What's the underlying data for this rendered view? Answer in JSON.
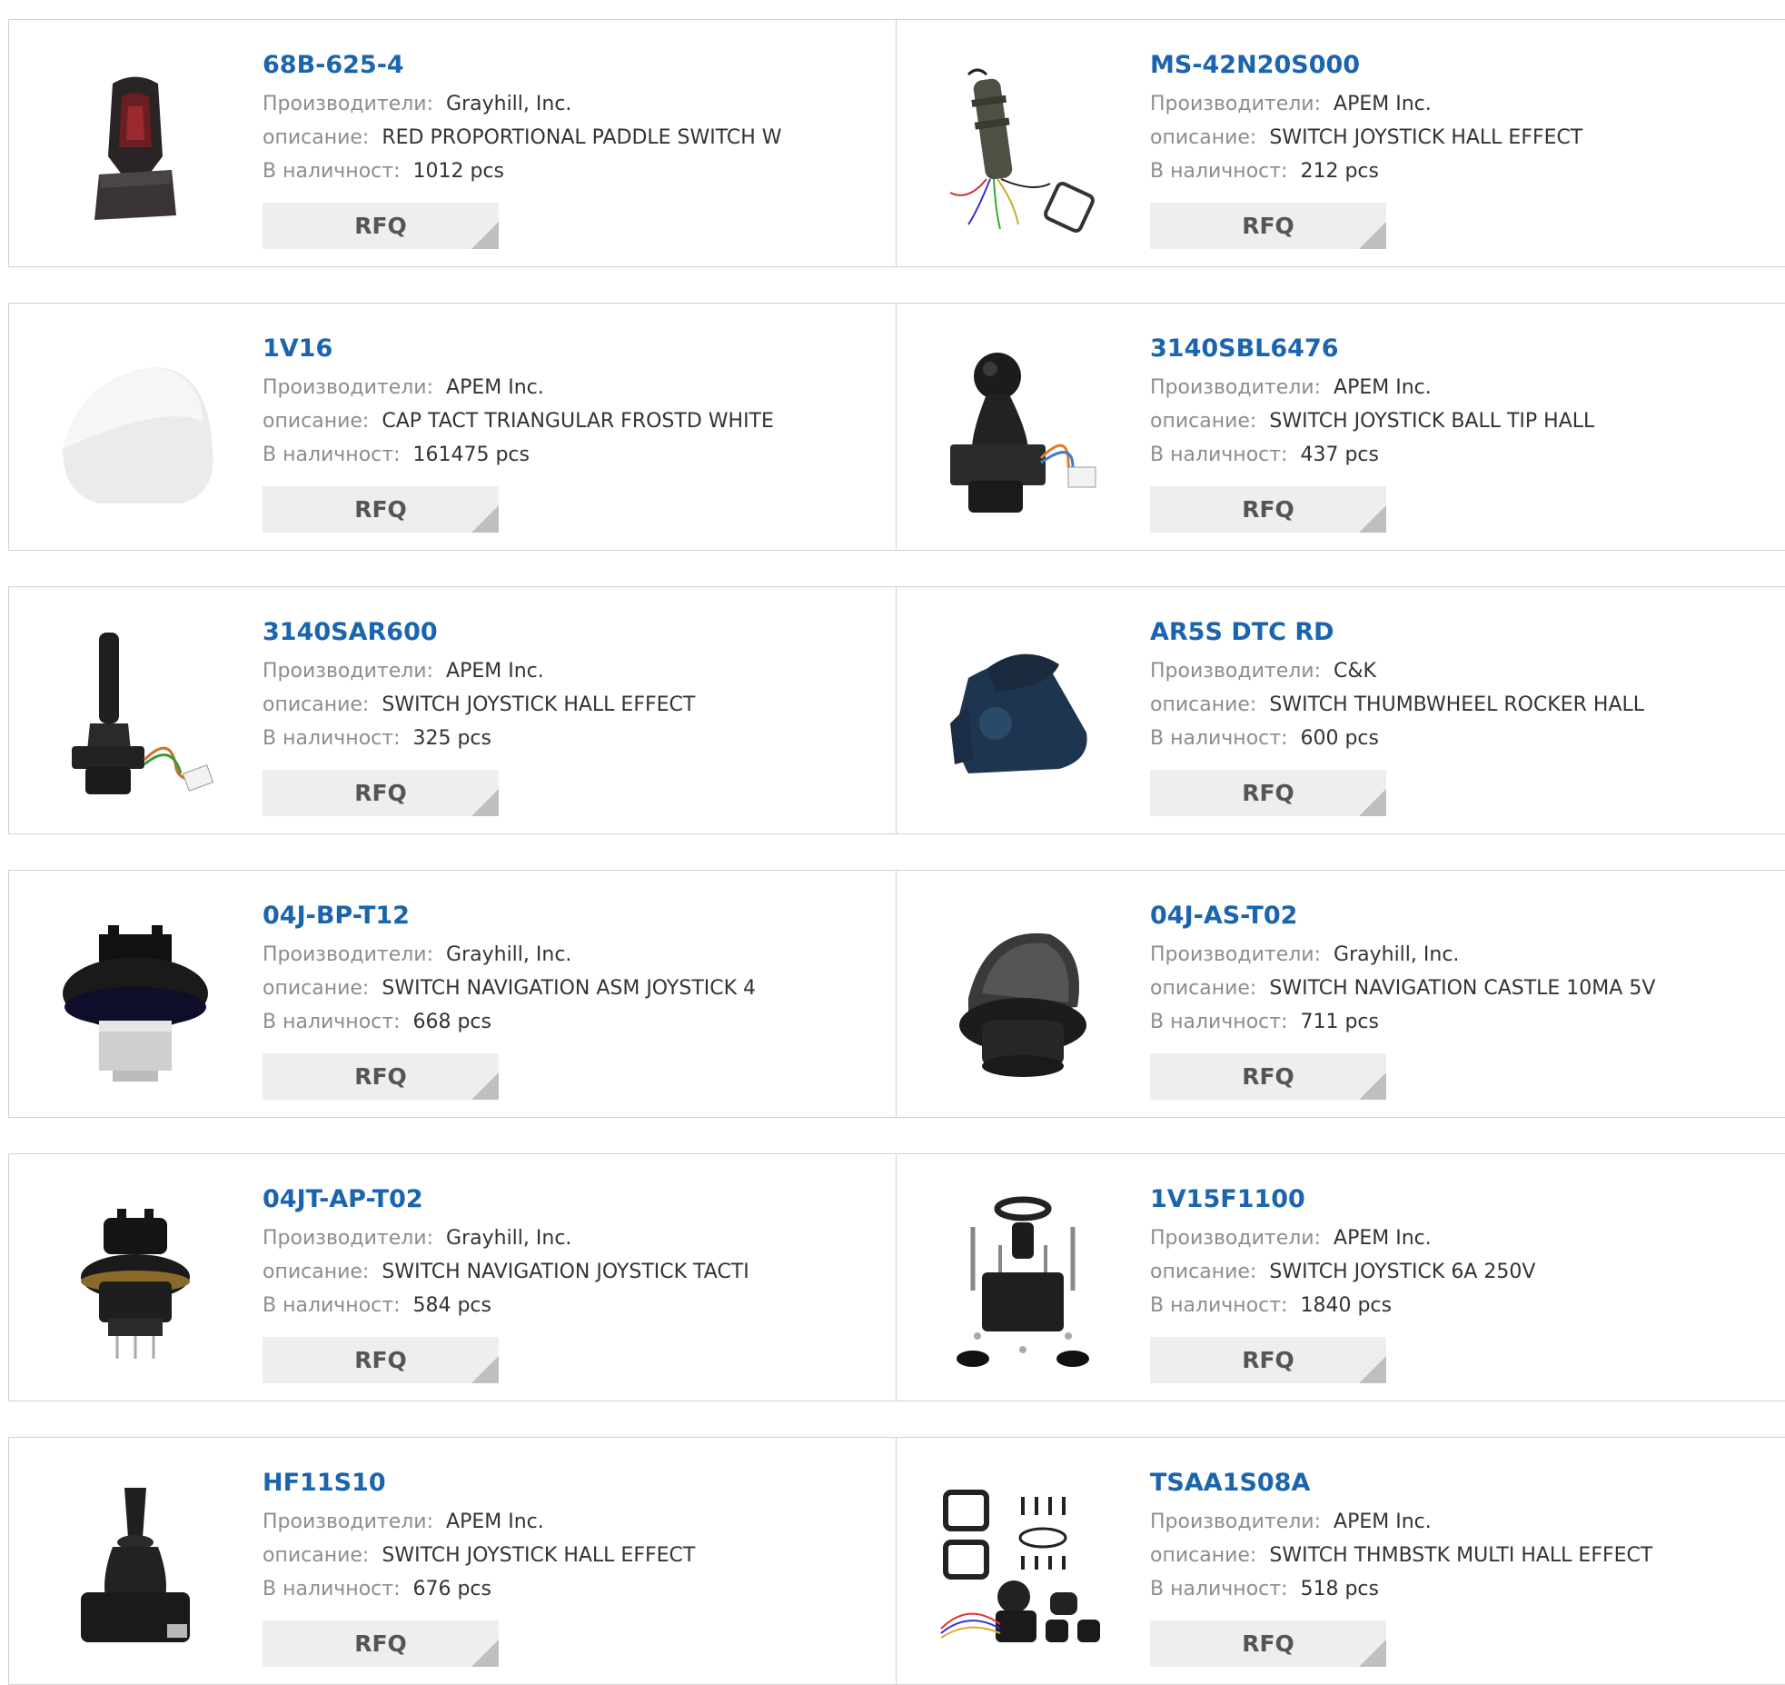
{
  "labels": {
    "manufacturer": "Производители:",
    "description": "описание:",
    "stock": "В наличност:",
    "rfq": "RFQ"
  },
  "products": [
    {
      "part": "68B-625-4",
      "manufacturer": "Grayhill, Inc.",
      "description": "RED PROPORTIONAL PADDLE SWITCH W",
      "stock": "1012 pcs",
      "icon": "paddle-switch-image"
    },
    {
      "part": "MS-42N20S000",
      "manufacturer": "APEM Inc.",
      "description": "SWITCH JOYSTICK HALL EFFECT",
      "stock": "212 pcs",
      "icon": "wired-joystick-image"
    },
    {
      "part": "1V16",
      "manufacturer": "APEM Inc.",
      "description": "CAP TACT TRIANGULAR FROSTD WHITE",
      "stock": "161475 pcs",
      "icon": "white-cap-image"
    },
    {
      "part": "3140SBL6476",
      "manufacturer": "APEM Inc.",
      "description": "SWITCH JOYSTICK BALL TIP HALL",
      "stock": "437 pcs",
      "icon": "ball-joystick-image"
    },
    {
      "part": "3140SAR600",
      "manufacturer": "APEM Inc.",
      "description": "SWITCH JOYSTICK HALL EFFECT",
      "stock": "325 pcs",
      "icon": "stick-joystick-image"
    },
    {
      "part": "AR5S DTC RD",
      "manufacturer": "C&K",
      "description": "SWITCH THUMBWHEEL ROCKER HALL",
      "stock": "600 pcs",
      "icon": "thumbwheel-image"
    },
    {
      "part": "04J-BP-T12",
      "manufacturer": "Grayhill, Inc.",
      "description": "SWITCH NAVIGATION ASM JOYSTICK 4",
      "stock": "668 pcs",
      "icon": "navigation-switch-image"
    },
    {
      "part": "04J-AS-T02",
      "manufacturer": "Grayhill, Inc.",
      "description": "SWITCH NAVIGATION CASTLE 10MA 5V",
      "stock": "711 pcs",
      "icon": "castle-switch-image"
    },
    {
      "part": "04JT-AP-T02",
      "manufacturer": "Grayhill, Inc.",
      "description": "SWITCH NAVIGATION JOYSTICK TACTI",
      "stock": "584 pcs",
      "icon": "tactile-joystick-image"
    },
    {
      "part": "1V15F1100",
      "manufacturer": "APEM Inc.",
      "description": "SWITCH JOYSTICK 6A 250V",
      "stock": "1840 pcs",
      "icon": "joystick-kit-image"
    },
    {
      "part": "HF11S10",
      "manufacturer": "APEM Inc.",
      "description": "SWITCH JOYSTICK HALL EFFECT",
      "stock": "676 pcs",
      "icon": "hall-joystick-image"
    },
    {
      "part": "TSAA1S08A",
      "manufacturer": "APEM Inc.",
      "description": "SWITCH THMBSTK MULTI HALL EFFECT",
      "stock": "518 pcs",
      "icon": "thumbstick-kit-image"
    }
  ]
}
